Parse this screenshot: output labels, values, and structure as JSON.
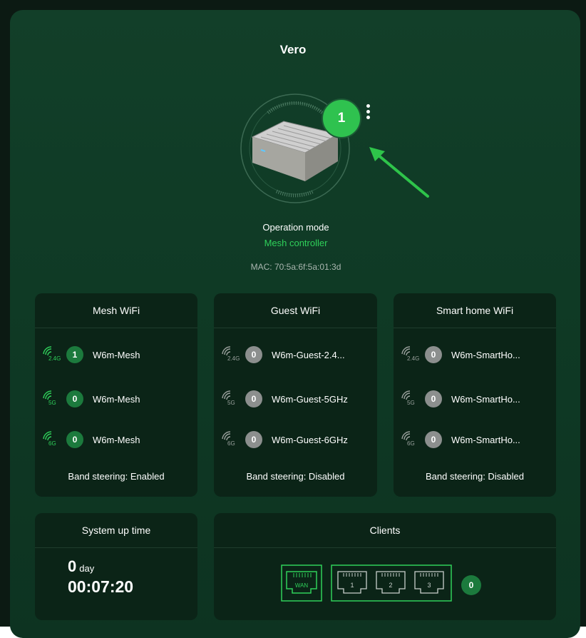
{
  "router": {
    "name": "Vero",
    "connected_nodes": "1",
    "operation_mode_label": "Operation mode",
    "operation_mode_value": "Mesh controller",
    "mac": "MAC: 70:5a:6f:5a:01:3d"
  },
  "cards": [
    {
      "title": "Mesh WiFi",
      "bands": [
        {
          "band": "2.4G",
          "count": "1",
          "ssid": "W6m-Mesh",
          "active": true
        },
        {
          "band": "5G",
          "count": "0",
          "ssid": "W6m-Mesh",
          "active": true
        },
        {
          "band": "6G",
          "count": "0",
          "ssid": "W6m-Mesh",
          "active": true
        }
      ],
      "steering": "Band steering: Enabled"
    },
    {
      "title": "Guest WiFi",
      "bands": [
        {
          "band": "2.4G",
          "count": "0",
          "ssid": "W6m-Guest-2.4...",
          "active": false
        },
        {
          "band": "5G",
          "count": "0",
          "ssid": "W6m-Guest-5GHz",
          "active": false
        },
        {
          "band": "6G",
          "count": "0",
          "ssid": "W6m-Guest-6GHz",
          "active": false
        }
      ],
      "steering": "Band steering: Disabled"
    },
    {
      "title": "Smart home WiFi",
      "bands": [
        {
          "band": "2.4G",
          "count": "0",
          "ssid": "W6m-SmartHo...",
          "active": false
        },
        {
          "band": "5G",
          "count": "0",
          "ssid": "W6m-SmartHo...",
          "active": false
        },
        {
          "band": "6G",
          "count": "0",
          "ssid": "W6m-SmartHo...",
          "active": false
        }
      ],
      "steering": "Band steering: Disabled"
    }
  ],
  "uptime": {
    "title": "System up time",
    "days": "0",
    "day_label": "day",
    "clock": "00:07:20"
  },
  "clients": {
    "title": "Clients",
    "wan_label": "WAN",
    "lan_ports": [
      "1",
      "2",
      "3"
    ],
    "count": "0"
  },
  "colors": {
    "accent": "#2fd05a",
    "panel": "#123f29",
    "card": "#0b2417",
    "inactive": "#8c8f8e"
  }
}
